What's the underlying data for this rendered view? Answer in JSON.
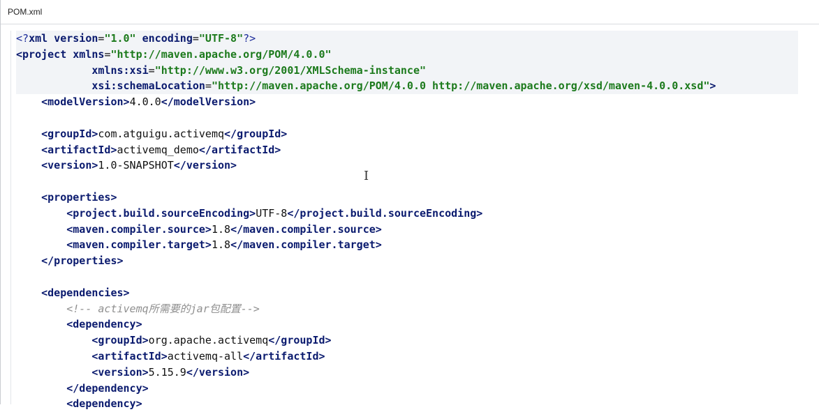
{
  "window": {
    "title": "POM.xml"
  },
  "editor": {
    "lines": [
      {
        "indent": "",
        "parts": [
          [
            "pi",
            "<?"
          ],
          [
            "tag",
            "xml"
          ],
          [
            "text",
            " "
          ],
          [
            "attr",
            "version"
          ],
          [
            "text",
            "="
          ],
          [
            "val",
            "\"1.0\""
          ],
          [
            "text",
            " "
          ],
          [
            "attr",
            "encoding"
          ],
          [
            "text",
            "="
          ],
          [
            "val",
            "\"UTF-8\""
          ],
          [
            "pi",
            "?>"
          ]
        ]
      },
      {
        "indent": "",
        "parts": [
          [
            "tag",
            "<project"
          ],
          [
            "text",
            " "
          ],
          [
            "attr",
            "xmlns"
          ],
          [
            "text",
            "="
          ],
          [
            "val",
            "\"http://maven.apache.org/POM/4.0.0\""
          ]
        ]
      },
      {
        "indent": "            ",
        "parts": [
          [
            "attr",
            "xmlns:xsi"
          ],
          [
            "text",
            "="
          ],
          [
            "val",
            "\"http://www.w3.org/2001/XMLSchema-instance\""
          ]
        ]
      },
      {
        "indent": "            ",
        "parts": [
          [
            "attr",
            "xsi:schemaLocation"
          ],
          [
            "text",
            "="
          ],
          [
            "val",
            "\"http://maven.apache.org/POM/4.0.0 http://maven.apache.org/xsd/maven-4.0.0.xsd\""
          ],
          [
            "tag",
            ">"
          ]
        ]
      },
      {
        "indent": "    ",
        "parts": [
          [
            "tag",
            "<modelVersion>"
          ],
          [
            "text",
            "4.0.0"
          ],
          [
            "tag",
            "</modelVersion>"
          ]
        ]
      },
      {
        "indent": "",
        "parts": []
      },
      {
        "indent": "    ",
        "parts": [
          [
            "tag",
            "<groupId>"
          ],
          [
            "text",
            "com.atguigu.activemq"
          ],
          [
            "tag",
            "</groupId>"
          ]
        ]
      },
      {
        "indent": "    ",
        "parts": [
          [
            "tag",
            "<artifactId>"
          ],
          [
            "text",
            "activemq_demo"
          ],
          [
            "tag",
            "</artifactId>"
          ]
        ]
      },
      {
        "indent": "    ",
        "parts": [
          [
            "tag",
            "<version>"
          ],
          [
            "text",
            "1.0-SNAPSHOT"
          ],
          [
            "tag",
            "</version>"
          ]
        ]
      },
      {
        "indent": "",
        "parts": []
      },
      {
        "indent": "    ",
        "parts": [
          [
            "tag",
            "<properties>"
          ]
        ]
      },
      {
        "indent": "        ",
        "parts": [
          [
            "tag",
            "<project.build.sourceEncoding>"
          ],
          [
            "text",
            "UTF-8"
          ],
          [
            "tag",
            "</project.build.sourceEncoding>"
          ]
        ]
      },
      {
        "indent": "        ",
        "parts": [
          [
            "tag",
            "<maven.compiler.source>"
          ],
          [
            "text",
            "1.8"
          ],
          [
            "tag",
            "</maven.compiler.source>"
          ]
        ]
      },
      {
        "indent": "        ",
        "parts": [
          [
            "tag",
            "<maven.compiler.target>"
          ],
          [
            "text",
            "1.8"
          ],
          [
            "tag",
            "</maven.compiler.target>"
          ]
        ]
      },
      {
        "indent": "    ",
        "parts": [
          [
            "tag",
            "</properties>"
          ]
        ]
      },
      {
        "indent": "",
        "parts": []
      },
      {
        "indent": "    ",
        "parts": [
          [
            "tag",
            "<dependencies>"
          ]
        ]
      },
      {
        "indent": "        ",
        "parts": [
          [
            "comment",
            "<!-- activemq所需要的jar包配置-->"
          ]
        ]
      },
      {
        "indent": "        ",
        "parts": [
          [
            "tag",
            "<dependency>"
          ]
        ]
      },
      {
        "indent": "            ",
        "parts": [
          [
            "tag",
            "<groupId>"
          ],
          [
            "text",
            "org.apache.activemq"
          ],
          [
            "tag",
            "</groupId>"
          ]
        ]
      },
      {
        "indent": "            ",
        "parts": [
          [
            "tag",
            "<artifactId>"
          ],
          [
            "text",
            "activemq-all"
          ],
          [
            "tag",
            "</artifactId>"
          ]
        ]
      },
      {
        "indent": "            ",
        "parts": [
          [
            "tag",
            "<version>"
          ],
          [
            "text",
            "5.15.9"
          ],
          [
            "tag",
            "</version>"
          ]
        ]
      },
      {
        "indent": "        ",
        "parts": [
          [
            "tag",
            "</dependency>"
          ]
        ]
      },
      {
        "indent": "        ",
        "parts": [
          [
            "tag",
            "<dependency>"
          ]
        ]
      }
    ]
  }
}
